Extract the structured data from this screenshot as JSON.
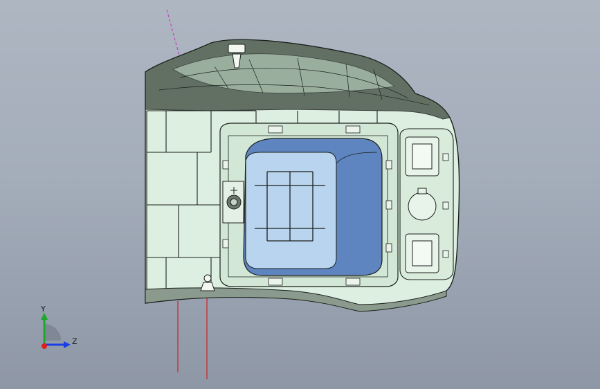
{
  "viewport": {
    "background_top": "#aeb6c2",
    "background_bottom": "#8e97a6"
  },
  "model": {
    "body_color": "#dcefe0",
    "edge_color": "#1b1f1b",
    "shadow_color": "#4d5a4f",
    "block_color": "#5e85c0",
    "block_highlight": "#b9d4ee",
    "axis_line_color": "#d02020",
    "pink_axis_color": "#c044c0"
  },
  "triad": {
    "y_label": "Y",
    "z_label": "Z",
    "y_axis_color": "#1ca82a",
    "z_axis_color": "#1a3ee6",
    "x_axis_color": "#e01f1f"
  }
}
